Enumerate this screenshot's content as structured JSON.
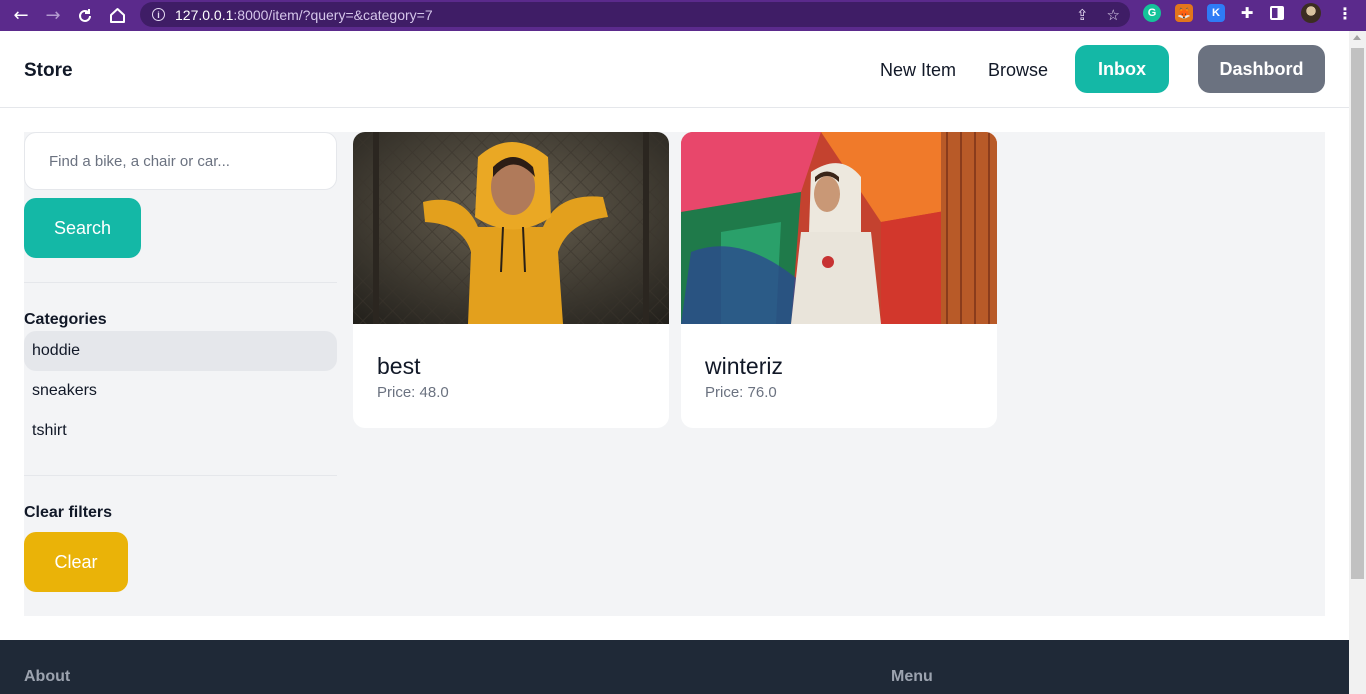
{
  "browser": {
    "url_host": "127.0.0.1",
    "url_rest": ":8000/item/?query=&category=7",
    "extensions": [
      "grammarly-icon",
      "metamask-icon",
      "k-extension-icon",
      "puzzle-icon",
      "side-panel-icon",
      "profile-avatar",
      "kebab-menu-icon"
    ]
  },
  "nav": {
    "brand": "Store",
    "new_item": "New Item",
    "browse": "Browse",
    "inbox": "Inbox",
    "dashboard": "Dashbord"
  },
  "sidebar": {
    "search_placeholder": "Find a bike, a chair or car...",
    "search_button": "Search",
    "categories_heading": "Categories",
    "categories": [
      {
        "label": "hoddie",
        "active": true
      },
      {
        "label": "sneakers",
        "active": false
      },
      {
        "label": "tshirt",
        "active": false
      }
    ],
    "clear_heading": "Clear filters",
    "clear_button": "Clear"
  },
  "items": [
    {
      "name": "best",
      "price": "Price: 48.0"
    },
    {
      "name": "winteriz",
      "price": "Price: 76.0"
    }
  ],
  "footer": {
    "about": "About",
    "menu": "Menu"
  },
  "colors": {
    "browser_bar": "#5b2a8c",
    "accent_teal": "#14b8a6",
    "dashboard_gray": "#6b7280",
    "clear_yellow": "#eab308",
    "panel_bg": "#f3f4f6",
    "footer_bg": "#1f2937"
  }
}
